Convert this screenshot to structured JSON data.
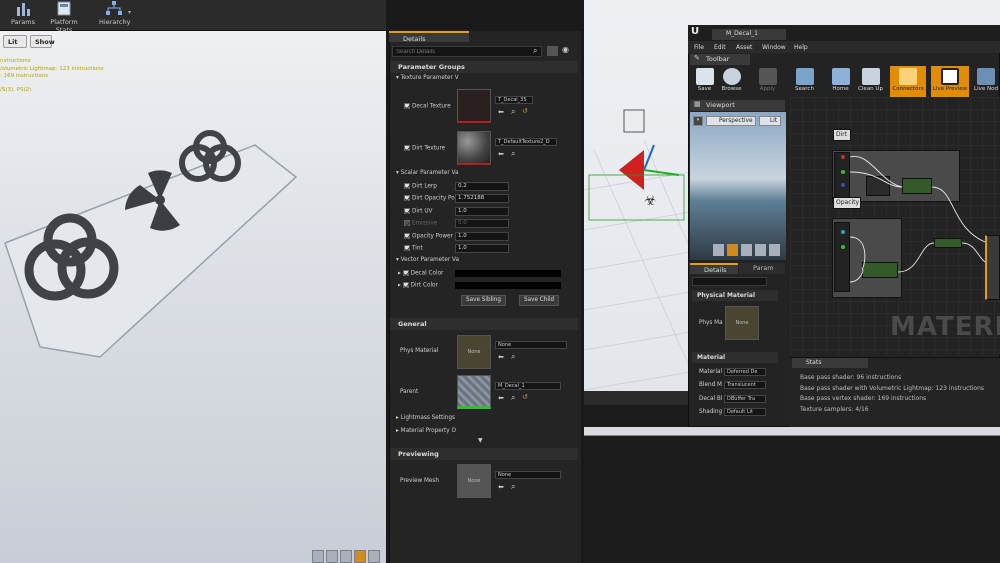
{
  "toolbar": {
    "params_label": "Params",
    "platform_stats_label": "Platform Stats",
    "hierarchy_label": "Hierarchy"
  },
  "viewport": {
    "lit_label": "Lit",
    "show_label": "Show",
    "stats": [
      "nstructions",
      "/olumetric Lightmap: 123 instructions",
      ": 169 instructions",
      "",
      "/S(3), PS(2)"
    ]
  },
  "details": {
    "tab_label": "Details",
    "search_placeholder": "Search Details",
    "parameter_groups": "Parameter Groups",
    "texture_group": "Texture Parameter V",
    "decal_texture_label": "Decal Texture",
    "decal_texture_value": "T_Decal_35",
    "dirt_texture_label": "Dirt Texture",
    "dirt_texture_value": "T_DefaultTexture2_D",
    "scalar_group": "Scalar Parameter Va",
    "scalars": [
      {
        "label": "Dirt Lerp",
        "value": "0.2"
      },
      {
        "label": "Dirt Opacity Po",
        "value": "1.752188"
      },
      {
        "label": "Dirt UV",
        "value": "1.0"
      },
      {
        "label": "Emissive",
        "value": "0.0"
      },
      {
        "label": "Opacity Power",
        "value": "1.0"
      },
      {
        "label": "Tint",
        "value": "1.0"
      }
    ],
    "vector_group": "Vector Parameter Va",
    "decal_color_label": "Decal Color",
    "dirt_color_label": "Dirt Color",
    "save_sibling": "Save Sibling",
    "save_child": "Save Child",
    "general_label": "General",
    "phys_material_label": "Phys Material",
    "phys_material_value": "None",
    "parent_label": "Parent",
    "parent_value": "M_Decal_1",
    "lightmass_label": "Lightmass Settings",
    "material_property_label": "Material Property O",
    "previewing_label": "Previewing",
    "preview_mesh_label": "Preview Mesh",
    "preview_mesh_value": "None",
    "thumb_none": "None"
  },
  "material_editor": {
    "tab_title": "M_Decal_1",
    "menu": [
      "File",
      "Edit",
      "Asset",
      "Window",
      "Help"
    ],
    "toolbar_label": "Toolbar",
    "tools": [
      "Save",
      "Browse",
      "Apply",
      "Search",
      "Home",
      "Clean Up",
      "Connectors",
      "Live Preview",
      "Live Nod"
    ],
    "viewport_label": "Viewport",
    "perspective_label": "Perspective",
    "lit_label": "Lit",
    "details_tab": "Details",
    "params_tab": "Param",
    "physical_material_label": "Physical Material",
    "phys_mat_label": "Phys Ma",
    "none_label": "None",
    "material_section": "Material",
    "material_props": [
      {
        "label": "Material",
        "value": "Deferred De"
      },
      {
        "label": "Blend M",
        "value": "Translucent"
      },
      {
        "label": "Decal Bl",
        "value": "DBuffer Tra"
      },
      {
        "label": "Shading",
        "value": "Default Lit"
      }
    ],
    "node_dirt": "Dirt",
    "node_opacity": "Opacity",
    "watermark": "MATERIA",
    "stats_label": "Stats",
    "stats_lines": [
      "Base pass shader: 96 instructions",
      "Base pass shader with Volumetric Lightmap: 123 instructions",
      "Base pass vertex shader: 169 instructions",
      "Texture samplers: 4/16"
    ]
  }
}
